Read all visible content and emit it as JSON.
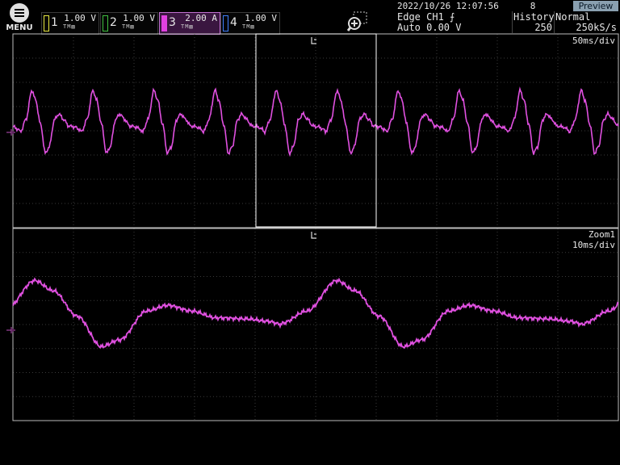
{
  "menu": {
    "label": "MENU",
    "icon": "hamburger-icon"
  },
  "channels": [
    {
      "num": "1",
      "value": "1.00 V",
      "color": "#e8e840",
      "selected": false
    },
    {
      "num": "2",
      "value": "1.00 V",
      "color": "#40c040",
      "selected": false
    },
    {
      "num": "3",
      "value": "2.00 A",
      "color": "#e040e0",
      "selected": true
    },
    {
      "num": "4",
      "value": "1.00 V",
      "color": "#4080ff",
      "selected": false
    }
  ],
  "zoom_tool": {
    "icon": "zoom-in-icon"
  },
  "status": {
    "datetime": "2022/10/26 12:07:56",
    "trigger_type": "Edge CH1",
    "trigger_mode": "Auto 0.00 V",
    "acq_count": "8",
    "history_label": "History",
    "history_value": "250",
    "mode_label": "Normal",
    "sample_rate": "250kS/s",
    "preview_label": "Preview"
  },
  "main": {
    "timebase": "50ms/div"
  },
  "zoom": {
    "label": "Zoom1",
    "timebase": "10ms/div"
  },
  "colors": {
    "trace": "#e050e0",
    "grid": "#3a3a3a",
    "frame": "#bdbdbd",
    "box": "#ffffff"
  }
}
